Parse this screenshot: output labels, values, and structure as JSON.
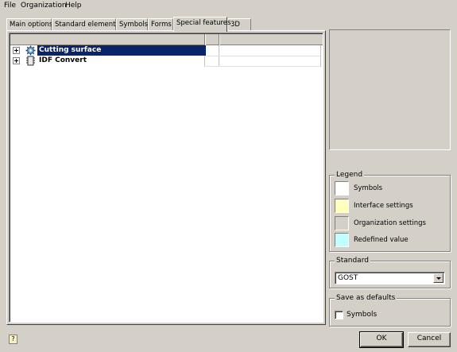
{
  "menu": {
    "file": "File",
    "organization": "Organization",
    "help": "Help"
  },
  "tabs": [
    {
      "label": "Main options"
    },
    {
      "label": "Standard elements"
    },
    {
      "label": "Symbols"
    },
    {
      "label": "Forms"
    },
    {
      "label": "Special features",
      "active": true
    },
    {
      "label": "3D"
    }
  ],
  "tree": {
    "items": [
      {
        "label": "Cutting surface",
        "icon": "gear-icon",
        "selected": true
      },
      {
        "label": "IDF Convert",
        "icon": "circuit-board-icon",
        "selected": false
      }
    ]
  },
  "legend": {
    "title": "Legend",
    "items": [
      {
        "label": "Symbols",
        "color": "#ffffff"
      },
      {
        "label": "Interface settings",
        "color": "#ffffc0"
      },
      {
        "label": "Organization settings",
        "color": "#d4d0c8"
      },
      {
        "label": "Redefined value",
        "color": "#c0ffff"
      }
    ]
  },
  "standard": {
    "title": "Standard",
    "value": "GOST"
  },
  "defaults": {
    "title": "Save as defaults",
    "checkbox_label": "Symbols",
    "checked": false
  },
  "buttons": {
    "ok": "OK",
    "cancel": "Cancel"
  },
  "colors": {
    "selection": "#0a246a",
    "face": "#d4d0c8"
  }
}
